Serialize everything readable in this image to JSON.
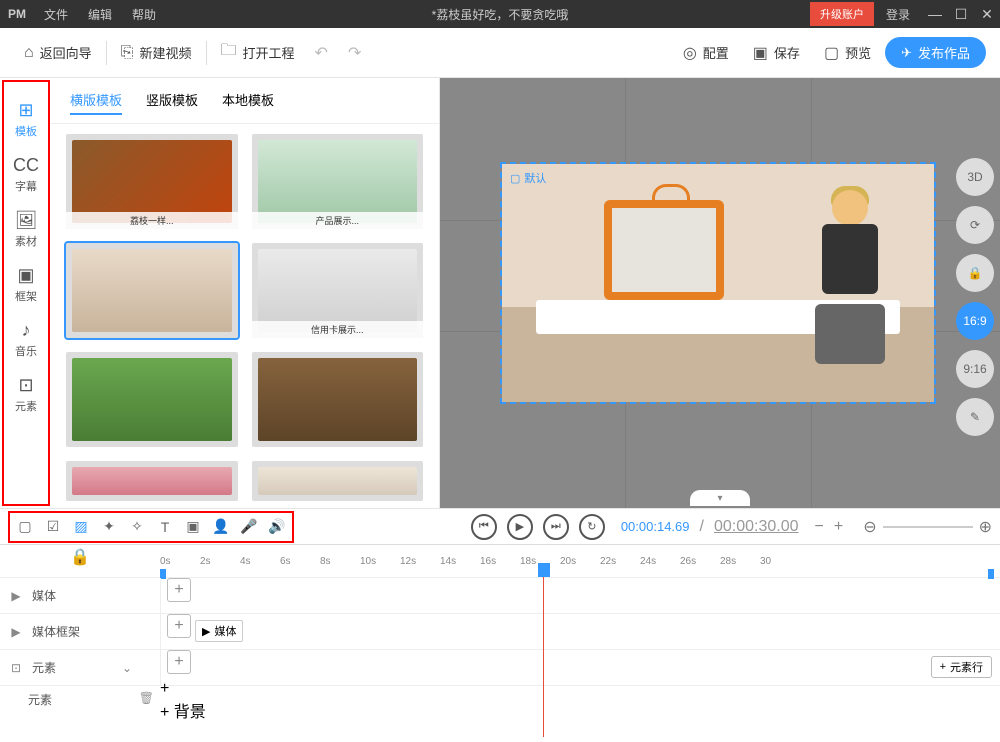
{
  "titlebar": {
    "logo": "PM",
    "menus": [
      "文件",
      "编辑",
      "帮助"
    ],
    "title": "*荔枝虽好吃，不要贪吃哦",
    "upgrade": "升级账户",
    "login": "登录"
  },
  "toolbar": {
    "back": "返回向导",
    "new": "新建视频",
    "open": "打开工程",
    "config": "配置",
    "save": "保存",
    "preview": "预览",
    "publish": "发布作品"
  },
  "sidebar": {
    "items": [
      {
        "label": "模板",
        "icon": "⊞"
      },
      {
        "label": "字幕",
        "icon": "CC"
      },
      {
        "label": "素材",
        "icon": "🖼"
      },
      {
        "label": "框架",
        "icon": "▣"
      },
      {
        "label": "音乐",
        "icon": "♪"
      },
      {
        "label": "元素",
        "icon": "⊡"
      }
    ]
  },
  "panel": {
    "tabs": [
      "横版模板",
      "竖版模板",
      "本地模板"
    ]
  },
  "canvas": {
    "default_label": "默认"
  },
  "preview_tools": {
    "items": [
      "3D",
      "⟳",
      "🔒",
      "16:9",
      "9:16",
      "✎"
    ]
  },
  "playback": {
    "current": "00:00:14.69",
    "duration": "00:00:30.00"
  },
  "ruler": [
    "0s",
    "2s",
    "4s",
    "6s",
    "8s",
    "10s",
    "12s",
    "14s",
    "16s",
    "18s",
    "20s",
    "22s",
    "24s",
    "26s",
    "28s",
    "30"
  ],
  "tracks": {
    "media": "媒体",
    "media_frame": "媒体框架",
    "frame_block": "媒体",
    "elements": "元素",
    "element_row": "元素行",
    "element_sub": "元素",
    "background": "背景"
  }
}
